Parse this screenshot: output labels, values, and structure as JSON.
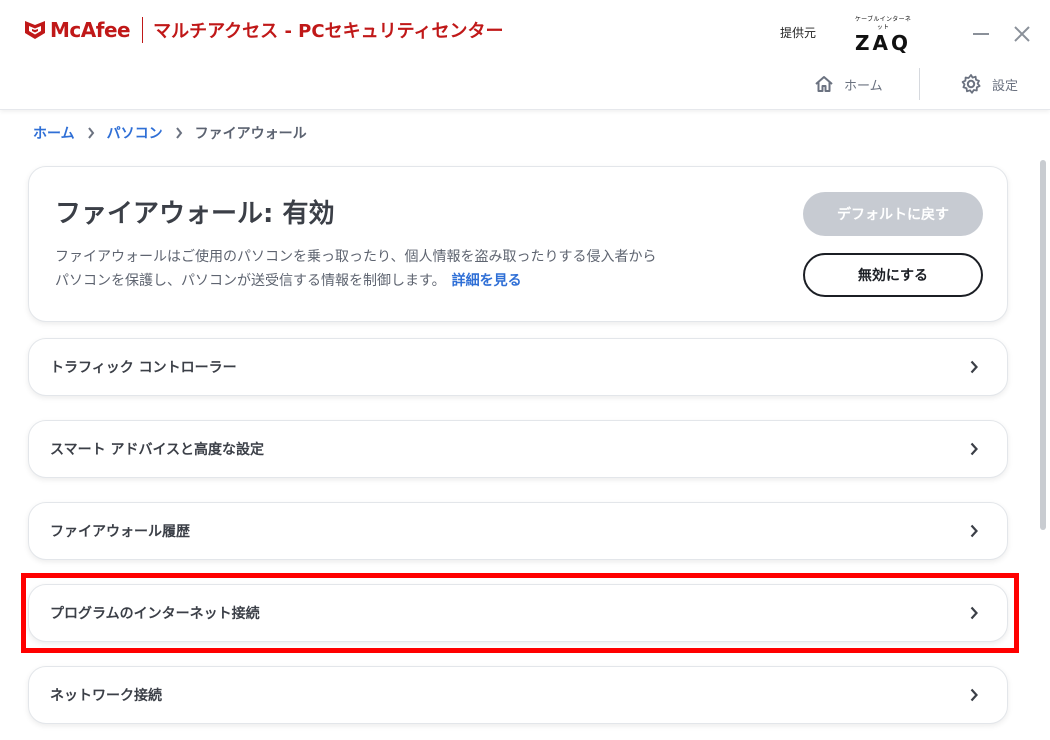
{
  "header": {
    "logo_text": "McAfee",
    "app_title": "マルチアクセス - PCセキュリティセンター",
    "provider_label": "提供元",
    "provider_logo_sub": "ケーブルインターネット",
    "provider_logo_main": "ZAQ",
    "nav": {
      "home_label": "ホーム",
      "settings_label": "設定"
    }
  },
  "breadcrumb": {
    "items": [
      "ホーム",
      "パソコン",
      "ファイアウォール"
    ]
  },
  "status_card": {
    "title": "ファイアウォール: 有効",
    "description_line1": "ファイアウォールはご使用のパソコンを乗っ取ったり、個人情報を盗み取ったりする侵入者から",
    "description_line2": "パソコンを保護し、パソコンが送受信する情報を制御します。",
    "more_link": "詳細を見る",
    "default_button": "デフォルトに戻す",
    "disable_button": "無効にする"
  },
  "settings_rows": [
    {
      "label": "トラフィック コントローラー"
    },
    {
      "label": "スマート アドバイスと高度な設定"
    },
    {
      "label": "ファイアウォール履歴"
    },
    {
      "label": "プログラムのインターネット接続"
    },
    {
      "label": "ネットワーク接続"
    }
  ],
  "colors": {
    "brand_red": "#c01818",
    "link_blue": "#2f6fd6",
    "highlight_red": "#ff0000",
    "disabled_button": "#c7cbd2"
  }
}
